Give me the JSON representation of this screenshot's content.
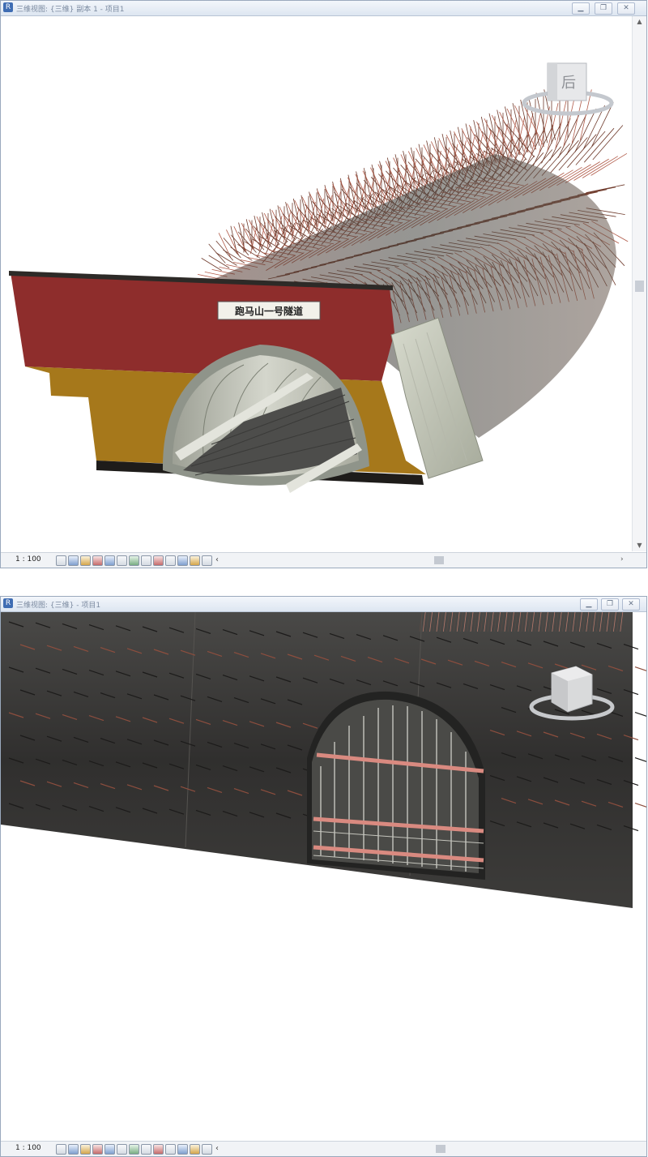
{
  "window1": {
    "title": "三维视图: {三维} 副本 1 - 项目1",
    "controls": {
      "minimize": "▁",
      "restore": "❐",
      "close": "✕"
    },
    "viewcube_face": "后",
    "portal_sign": "跑马山一号隧道",
    "status": {
      "scale": "1 : 100",
      "overflow": "‹",
      "scroll_right": "›"
    }
  },
  "window2": {
    "title": "三维视图: {三维} - 项目1",
    "controls": {
      "minimize": "▁",
      "restore": "❐",
      "close": "✕"
    },
    "status": {
      "scale": "1 : 100",
      "overflow": "‹"
    }
  },
  "colors": {
    "portal_red": "#8e2d2c",
    "portal_ochre": "#a6781b",
    "lining_gray": "#c9cbc1",
    "bolt_rust": "#6f3b2c",
    "tunnel_dark": "#3b3a38",
    "window_border": "#9aa9bd"
  }
}
